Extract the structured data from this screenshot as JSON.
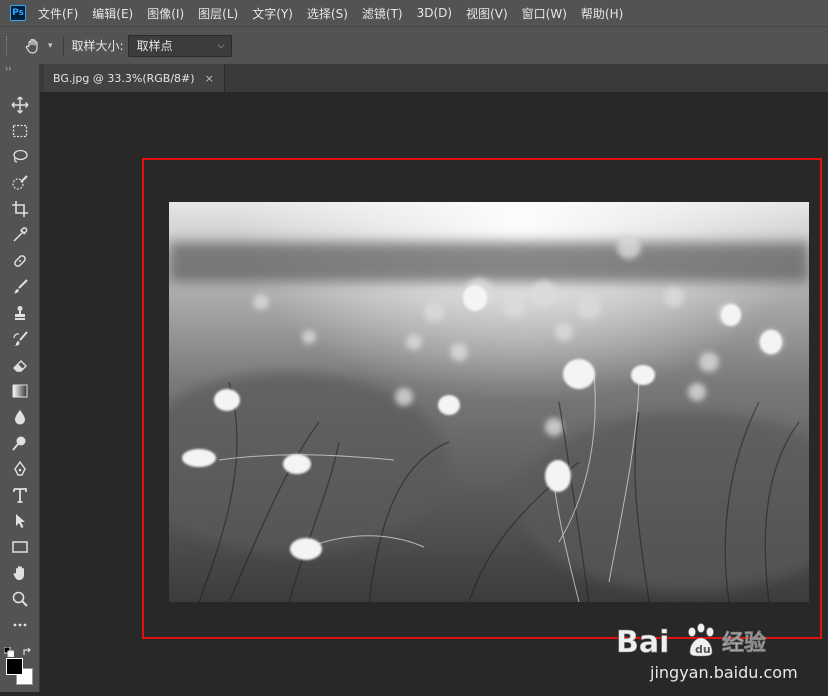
{
  "app": {
    "logo_text": "Ps"
  },
  "menu": [
    "文件(F)",
    "编辑(E)",
    "图像(I)",
    "图层(L)",
    "文字(Y)",
    "选择(S)",
    "滤镜(T)",
    "3D(D)",
    "视图(V)",
    "窗口(W)",
    "帮助(H)"
  ],
  "options": {
    "sample_size_label": "取样大小:",
    "sample_size_value": "取样点"
  },
  "document": {
    "tab_title": "BG.jpg @ 33.3%(RGB/8#)",
    "close_glyph": "×"
  },
  "toolbar": {
    "collapse_glyph": "››"
  },
  "tools": [
    "move-tool",
    "marquee-tool",
    "lasso-tool",
    "quick-selection-tool",
    "crop-tool",
    "eyedropper-tool",
    "healing-brush-tool",
    "brush-tool",
    "clone-stamp-tool",
    "history-brush-tool",
    "eraser-tool",
    "gradient-tool",
    "blur-tool",
    "dodge-tool",
    "pen-tool",
    "type-tool",
    "path-selection-tool",
    "rectangle-tool",
    "hand-tool",
    "zoom-tool",
    "more-tools"
  ],
  "colors": {
    "foreground": "#000000",
    "background": "#ffffff",
    "highlight": "#e01010"
  },
  "watermark": {
    "brand": "Bai",
    "brand_suffix": "经验",
    "url": "jingyan.baidu.com"
  }
}
